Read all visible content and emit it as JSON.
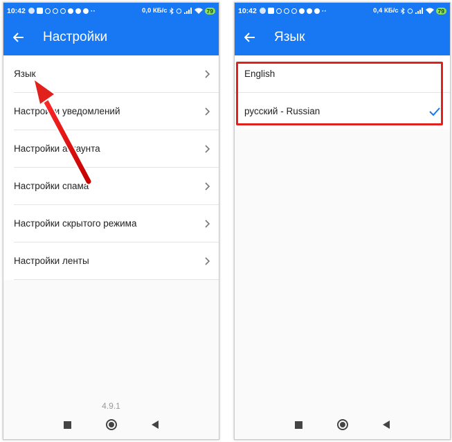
{
  "left_screen": {
    "status": {
      "time": "10:42",
      "speed": "0,0 КБ/с",
      "battery": "79"
    },
    "title": "Настройки",
    "items": [
      {
        "label": "Язык"
      },
      {
        "label": "Настройки уведомлений"
      },
      {
        "label": "Настройки аккаунта"
      },
      {
        "label": "Настройки спама"
      },
      {
        "label": "Настройки скрытого режима"
      },
      {
        "label": "Настройки ленты"
      }
    ],
    "version": "4.9.1"
  },
  "right_screen": {
    "status": {
      "time": "10:42",
      "speed": "0,4 КБ/с",
      "battery": "79"
    },
    "title": "Язык",
    "languages": [
      {
        "label": "English",
        "selected": false
      },
      {
        "label": "русский - Russian",
        "selected": true
      }
    ]
  },
  "colors": {
    "primary": "#1877f2",
    "annotation": "#e0211c",
    "check": "#1877f2"
  },
  "icons": [
    "back-arrow-icon",
    "chevron-right-icon",
    "check-icon",
    "nav-recents-icon",
    "nav-home-icon",
    "nav-back-icon"
  ]
}
